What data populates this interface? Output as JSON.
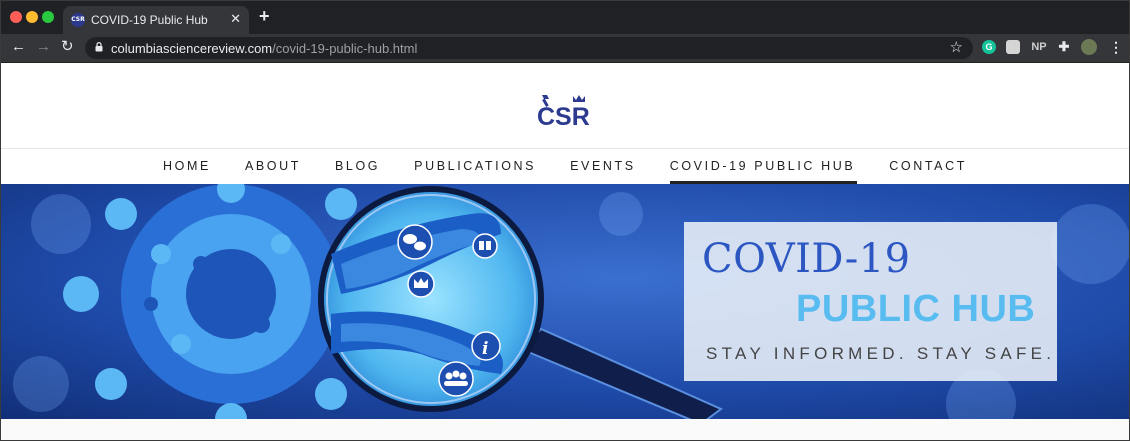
{
  "browser": {
    "tab": {
      "title": "COVID-19 Public Hub",
      "favicon_text": "CSR",
      "close_glyph": "✕"
    },
    "new_tab_glyph": "+",
    "nav": {
      "back_glyph": "←",
      "forward_glyph": "→",
      "reload_glyph": "↻"
    },
    "url": {
      "domain": "columbiasciencereview.com",
      "path": "/covid-19-public-hub.html"
    },
    "bookmark_glyph": "☆",
    "extensions": {
      "np_label": "NP",
      "menu_glyph": "⋮",
      "puzzle_glyph": "✚",
      "g_label": "G"
    }
  },
  "site": {
    "logo_text": "CSR",
    "nav": [
      {
        "label": "HOME"
      },
      {
        "label": "ABOUT"
      },
      {
        "label": "BLOG"
      },
      {
        "label": "PUBLICATIONS"
      },
      {
        "label": "EVENTS"
      },
      {
        "label": "COVID-19 PUBLIC HUB",
        "active": true
      },
      {
        "label": "CONTACT"
      }
    ],
    "hero": {
      "title_line1": "COVID-19",
      "title_line2": "PUBLIC HUB",
      "tagline": "STAY INFORMED. STAY SAFE."
    }
  },
  "colors": {
    "accent_blue": "#2c57c2",
    "light_blue": "#58bcf0",
    "hero_bg": "#1b47a8",
    "logo_navy": "#2b3a8f"
  }
}
